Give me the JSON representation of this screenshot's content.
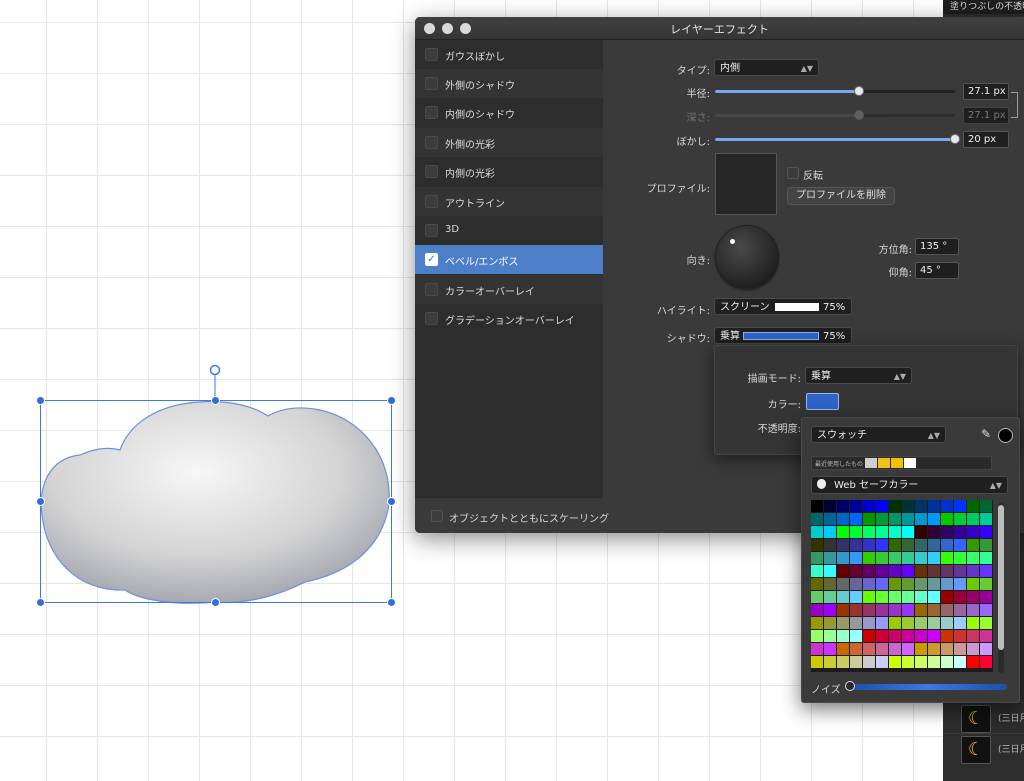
{
  "dialog": {
    "title": "レイヤーエフェクト",
    "effects": [
      {
        "label": "ガウスぼかし",
        "checked": false
      },
      {
        "label": "外側のシャドウ",
        "checked": false
      },
      {
        "label": "内側のシャドウ",
        "checked": false
      },
      {
        "label": "外側の光彩",
        "checked": false
      },
      {
        "label": "内側の光彩",
        "checked": false
      },
      {
        "label": "アウトライン",
        "checked": false
      },
      {
        "label": "3D",
        "checked": false
      },
      {
        "label": "ベベル/エンボス",
        "checked": true
      },
      {
        "label": "カラーオーバーレイ",
        "checked": false
      },
      {
        "label": "グラデーションオーバーレイ",
        "checked": false
      }
    ],
    "check_mark": "✓",
    "scale_with_object": "オブジェクトとともにスケーリング",
    "type_label": "タイプ:",
    "type_value": "内側",
    "radius_label": "半径:",
    "radius_value": "27.1 px",
    "radius_level": 0.6,
    "depth_label": "深さ:",
    "depth_value": "27.1 px",
    "depth_level": 0.6,
    "blur_label": "ぼかし:",
    "blur_value": "20 px",
    "blur_level": 1.0,
    "profile_label": "プロファイル:",
    "invert_label": "反転",
    "delete_profile": "プロファイルを削除",
    "direction_label": "向き:",
    "azimuth_label": "方位角:",
    "azimuth_value": "135 °",
    "elevation_label": "仰角:",
    "elevation_value": "45 °",
    "highlight_label": "ハイライト:",
    "highlight_mode": "スクリーン",
    "highlight_color": "#ffffff",
    "highlight_opacity": "75%",
    "shadow_label": "シャドウ:",
    "shadow_mode": "乗算",
    "shadow_color": "#2e64c8",
    "shadow_opacity": "75%"
  },
  "shadow_popover": {
    "blend_mode_label": "描画モード:",
    "blend_mode_value": "乗算",
    "color_label": "カラー:",
    "color_value": "#2e64c8",
    "opacity_label": "不透明度:"
  },
  "swatch_popover": {
    "mode_value": "スウォッチ",
    "recent_label": "最近使用したもの",
    "recent_colors": [
      "#d0d0d0",
      "#f3c21a",
      "#f6c000",
      "#ffffff"
    ],
    "palette_name": "Web セーフカラー",
    "noise_label": "ノイズ",
    "apple_icon": "apple-icon"
  },
  "right_panel": {
    "header": "塗りつぶしの不透明度",
    "rows": [
      {
        "label": "(三日月",
        "icon": "moon-icon"
      },
      {
        "label": "(三日月",
        "icon": "moon-icon"
      }
    ],
    "moon_glyph": "☾"
  },
  "colors": {
    "accent": "#2f6fd6",
    "selection": "#4d7fc9",
    "panel_dark": "#2d2d2d",
    "panel": "#3a3a3a"
  }
}
